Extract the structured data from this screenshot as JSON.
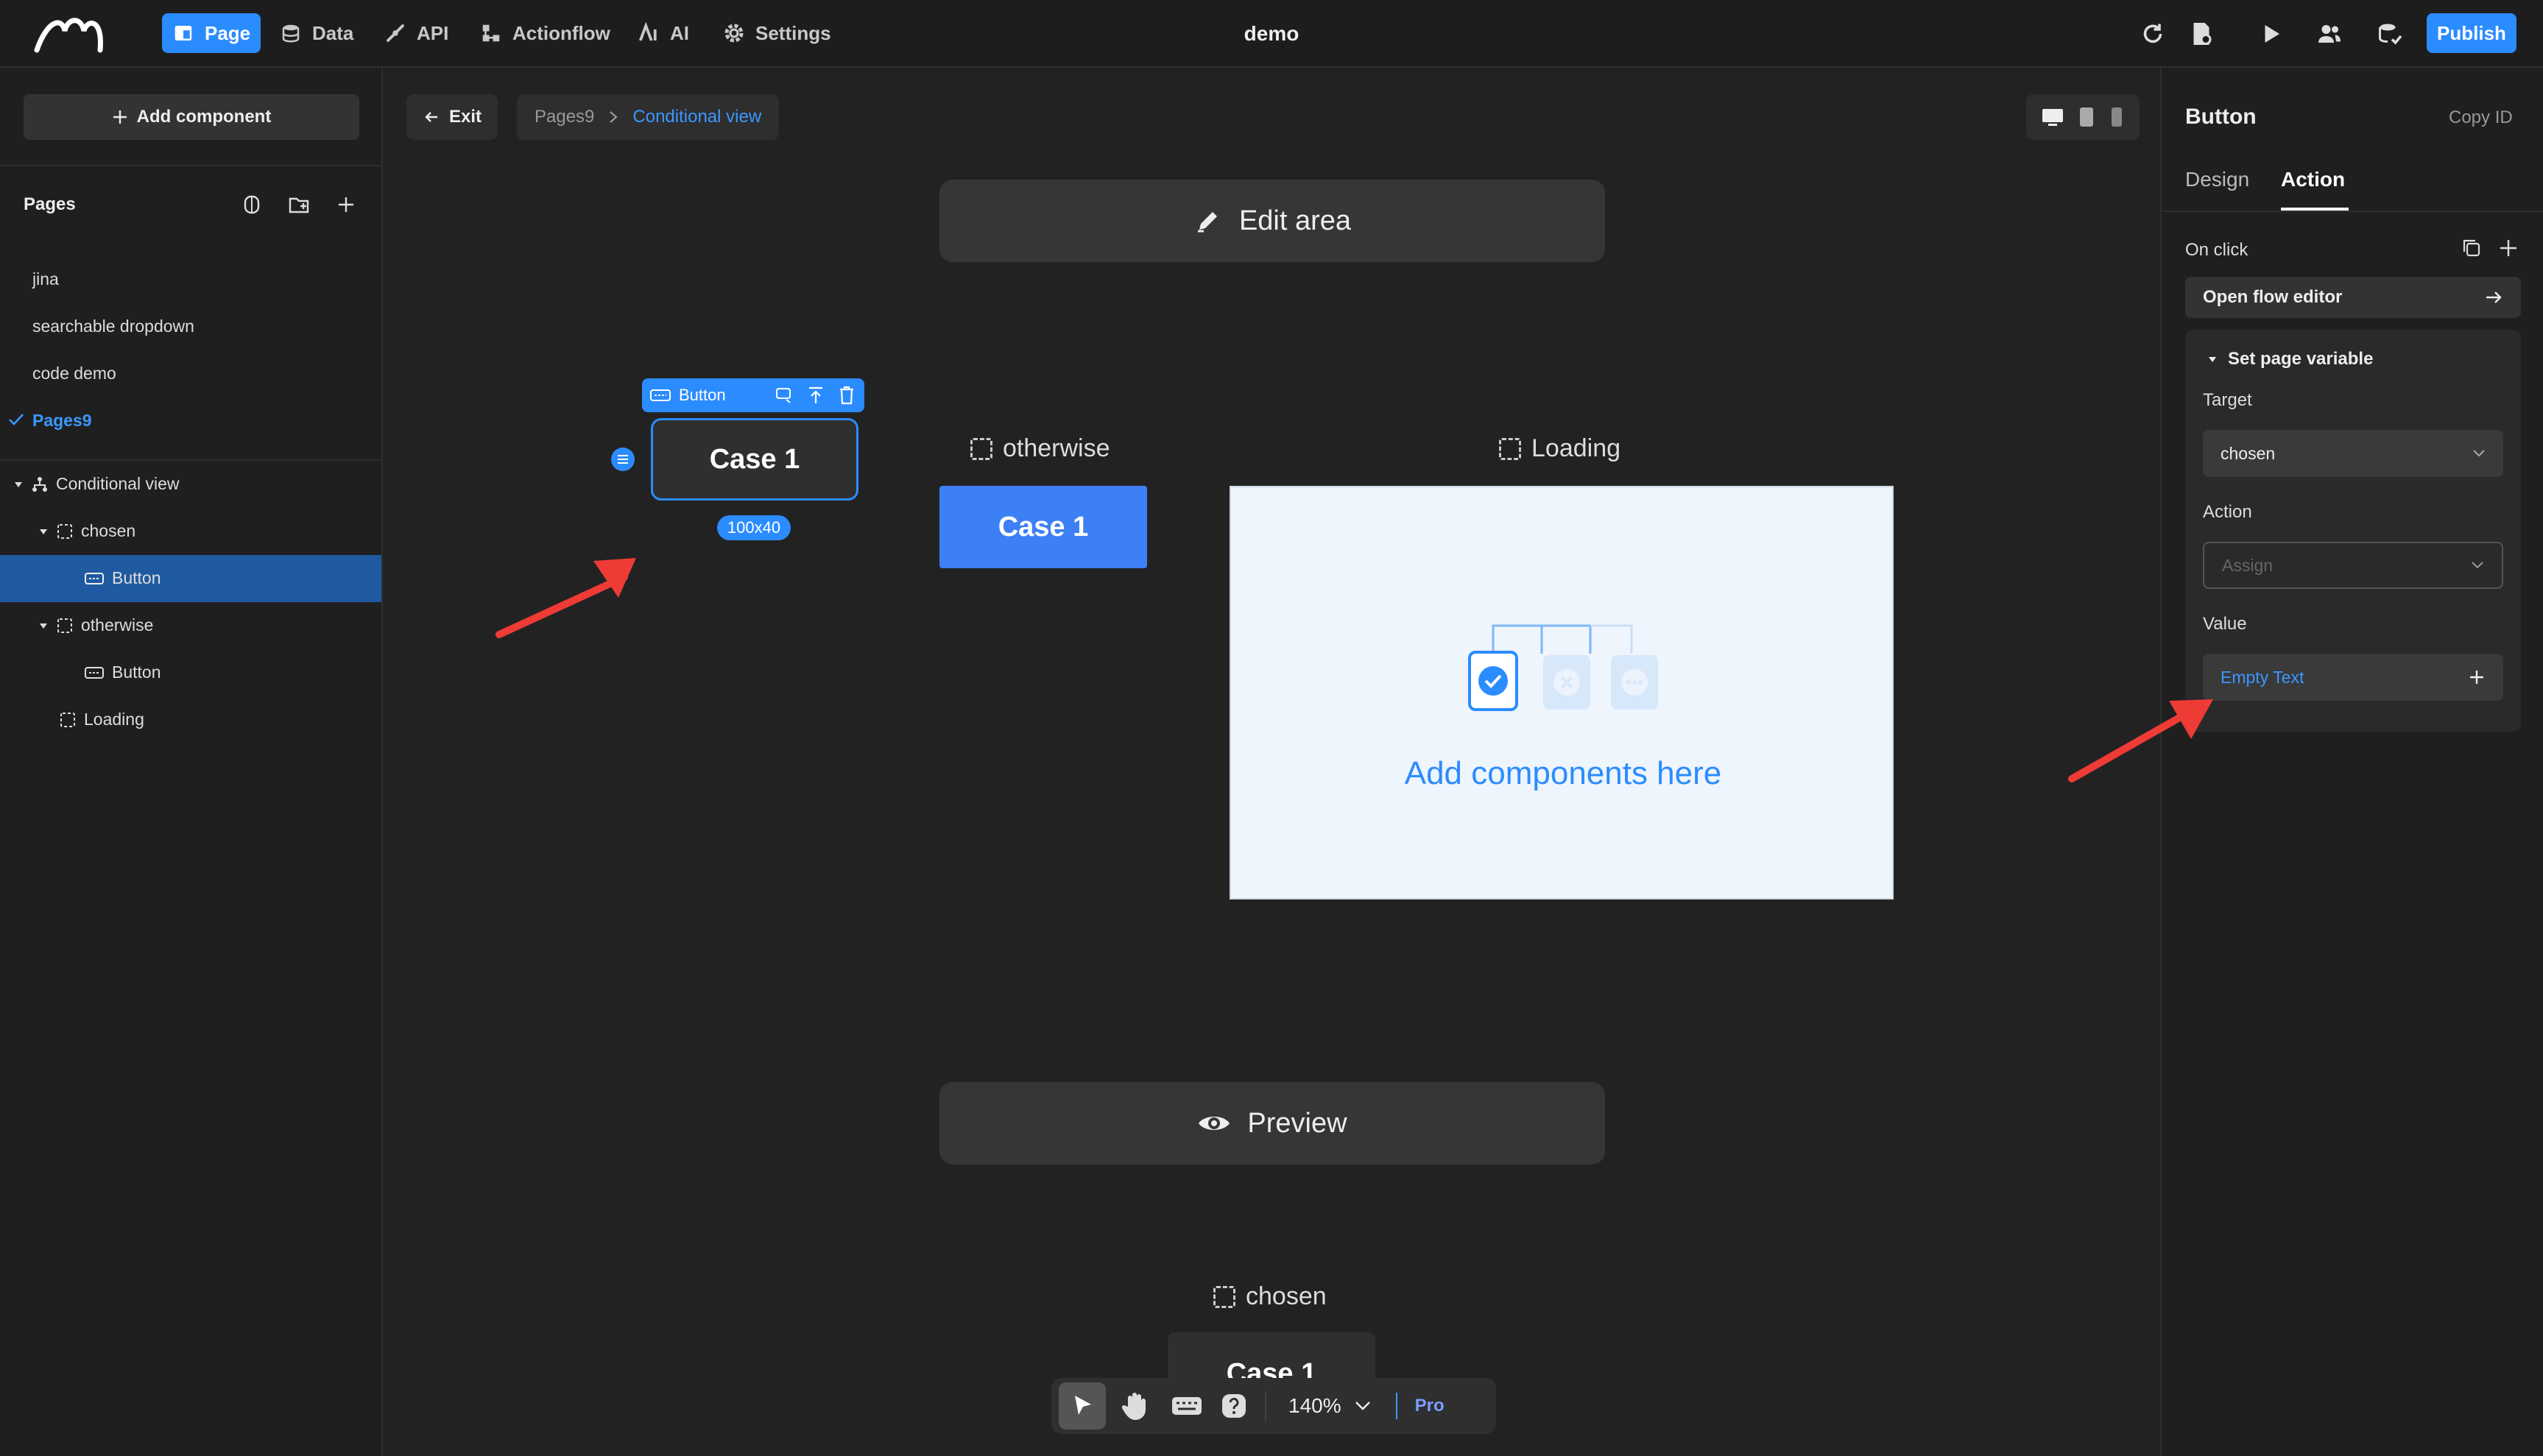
{
  "topbar": {
    "nav": [
      {
        "label": "Page",
        "icon": "page-icon"
      },
      {
        "label": "Data",
        "icon": "database-icon"
      },
      {
        "label": "API",
        "icon": "api-icon"
      },
      {
        "label": "Actionflow",
        "icon": "flow-icon"
      },
      {
        "label": "AI",
        "icon": "ai-icon"
      },
      {
        "label": "Settings",
        "icon": "gear-icon"
      }
    ],
    "project_title": "demo",
    "publish_label": "Publish",
    "accent": "#2b8cff"
  },
  "left": {
    "add_component": "Add component",
    "pages_title": "Pages",
    "pages": [
      "jina",
      "searchable dropdown",
      "code demo",
      "Pages9"
    ],
    "tree": {
      "root": "Conditional view",
      "chosen": "chosen",
      "chosen_button": "Button",
      "otherwise": "otherwise",
      "otherwise_button": "Button",
      "loading": "Loading"
    }
  },
  "canvas": {
    "exit_label": "Exit",
    "breadcrumb": [
      "Pages9",
      "Conditional view"
    ],
    "edit_area": "Edit area",
    "preview": "Preview",
    "labels": {
      "otherwise": "otherwise",
      "loading": "Loading",
      "chosen": "chosen"
    },
    "case_label": "Case 1",
    "selection_label": "Button",
    "size_badge": "100x40",
    "placeholder_text": "Add components here",
    "zoom": "140%",
    "pro": "Pro"
  },
  "right": {
    "title": "Button",
    "copy_id": "Copy ID",
    "tabs": [
      "Design",
      "Action"
    ],
    "on_click": "On click",
    "open_flow_editor": "Open flow editor",
    "card_title": "Set page variable",
    "target_label": "Target",
    "target_value": "chosen",
    "action_label": "Action",
    "action_placeholder": "Assign",
    "value_label": "Value",
    "value_text": "Empty Text"
  }
}
